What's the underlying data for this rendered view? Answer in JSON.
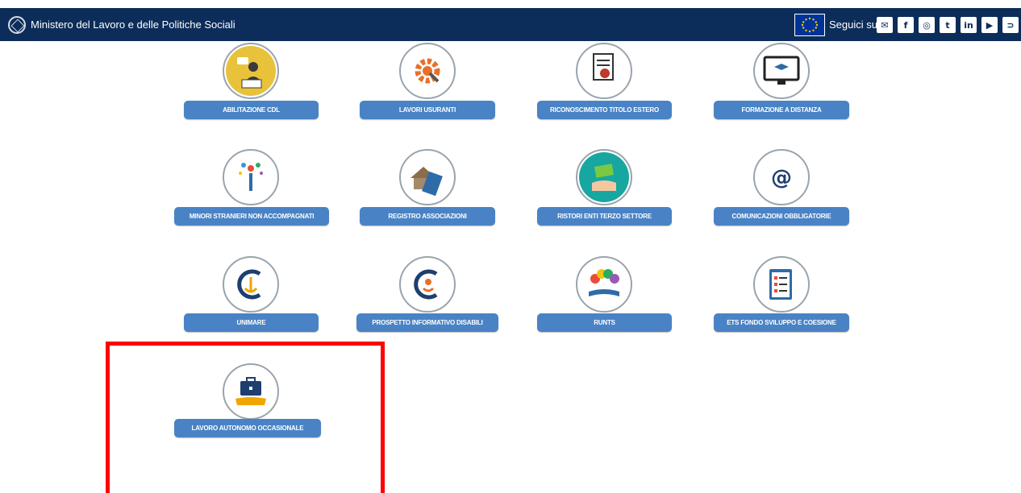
{
  "header": {
    "ministry_name": "Ministero del Lavoro e delle Politiche Sociali",
    "follow_label": "Seguici su:",
    "social": [
      {
        "icon": "mail-icon",
        "glyph": "✉"
      },
      {
        "icon": "facebook-icon",
        "glyph": "f"
      },
      {
        "icon": "instagram-icon",
        "glyph": "◎"
      },
      {
        "icon": "twitter-icon",
        "glyph": "t"
      },
      {
        "icon": "linkedin-icon",
        "glyph": "in"
      },
      {
        "icon": "youtube-icon",
        "glyph": "▶"
      },
      {
        "icon": "rss-icon",
        "glyph": "⊃"
      }
    ]
  },
  "tiles": [
    {
      "label": "ABILITAZIONE CDL",
      "icon": "consultant-icon"
    },
    {
      "label": "LAVORI USURANTI",
      "icon": "gear-search-icon"
    },
    {
      "label": "RICONOSCIMENTO TITOLO ESTERO",
      "icon": "certificate-icon"
    },
    {
      "label": "FORMAZIONE A DISTANZA",
      "icon": "monitor-graduation-icon"
    },
    {
      "label": "MINORI STRANIERI NON ACCOMPAGNATI",
      "icon": "child-flowers-icon"
    },
    {
      "label": "REGISTRO ASSOCIAZIONI",
      "icon": "house-book-icon"
    },
    {
      "label": "RISTORI ENTI TERZO SETTORE",
      "icon": "money-hand-icon"
    },
    {
      "label": "COMUNICAZIONI OBBLIGATORIE",
      "icon": "at-sign-icon"
    },
    {
      "label": "UNIMARE",
      "icon": "anchor-icon"
    },
    {
      "label": "PROSPETTO INFORMATIVO DISABILI",
      "icon": "accessibility-icon"
    },
    {
      "label": "RUNTS",
      "icon": "hands-book-icon"
    },
    {
      "label": "ETS FONDO SVILUPPO E COESIONE",
      "icon": "clipboard-checklist-icon"
    },
    {
      "label": "LAVORO AUTONOMO OCCASIONALE",
      "icon": "briefcase-hand-icon"
    }
  ],
  "colors": {
    "header_bg": "#0c2d5a",
    "button_bg": "#4a83c5",
    "highlight_border": "#ff0000"
  }
}
